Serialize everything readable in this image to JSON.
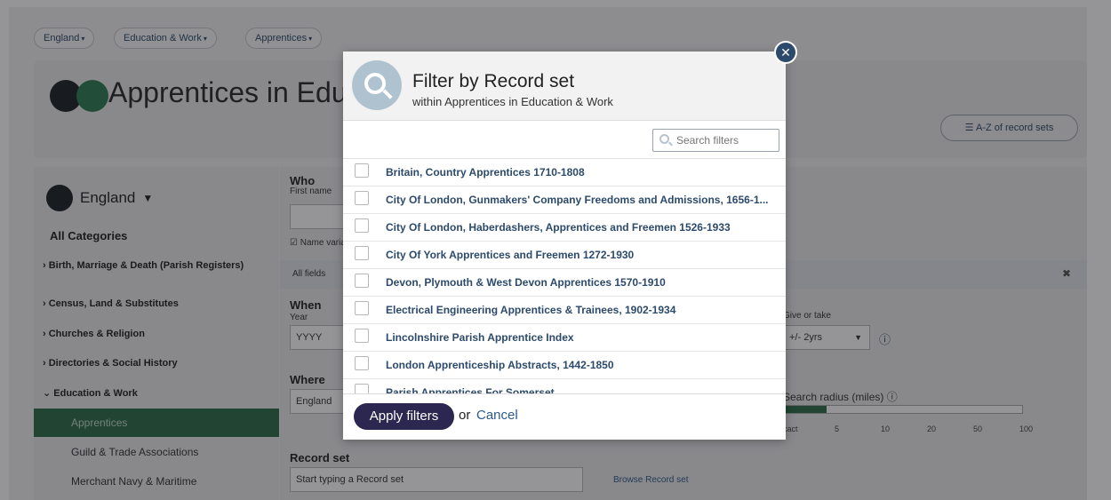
{
  "breadcrumbs": [
    {
      "label": "England"
    },
    {
      "label": "Education & Work"
    },
    {
      "label": "Apprentices"
    }
  ],
  "page": {
    "title": "Apprentices in Education & Work",
    "az_button": "A-Z of record sets"
  },
  "sidebar": {
    "region": "England",
    "all_categories": "All Categories",
    "categories": [
      {
        "label": "Birth, Marriage & Death (Parish Registers)"
      },
      {
        "label": "Census, Land & Substitutes"
      },
      {
        "label": "Churches & Religion"
      },
      {
        "label": "Directories & Social History"
      },
      {
        "label": "Education & Work"
      }
    ],
    "subcategories": [
      {
        "label": "Apprentices",
        "active": true
      },
      {
        "label": "Guild & Trade Associations",
        "active": false
      },
      {
        "label": "Merchant Navy & Maritime",
        "active": false
      }
    ]
  },
  "form": {
    "who_label": "Who",
    "first_name_label": "First name",
    "name_variants": "Name variants",
    "all_fields": "All fields",
    "when_label": "When",
    "year_label": "Year",
    "year_placeholder": "YYYY",
    "give_or_take": "Give or take",
    "give_or_take_value": "+/- 2yrs",
    "where_label": "Where",
    "where_value": "England",
    "search_radius_label": "Search radius (miles)",
    "radius_ticks": [
      "Exact",
      "5",
      "10",
      "20",
      "50",
      "100"
    ],
    "record_set_label": "Record set",
    "record_set_placeholder": "Start typing a Record set",
    "browse_record_set": "Browse Record set"
  },
  "modal": {
    "title": "Filter by Record set",
    "subtitle": "within Apprentices in Education & Work",
    "search_placeholder": "Search filters",
    "items": [
      {
        "label": "Britain, Country Apprentices 1710-1808",
        "checked": false
      },
      {
        "label": "City Of London, Gunmakers' Company Freedoms and Admissions, 1656-1...",
        "checked": false
      },
      {
        "label": "City Of London, Haberdashers, Apprentices and Freemen 1526-1933",
        "checked": false
      },
      {
        "label": "City Of York Apprentices and Freemen 1272-1930",
        "checked": false
      },
      {
        "label": "Devon, Plymouth & West Devon Apprentices 1570-1910",
        "checked": false
      },
      {
        "label": "Electrical Engineering Apprentices & Trainees, 1902-1934",
        "checked": false
      },
      {
        "label": "Lincolnshire Parish Apprentice Index",
        "checked": false
      },
      {
        "label": "London Apprenticeship Abstracts, 1442-1850",
        "checked": false
      },
      {
        "label": "Parish Apprentices For Somerset",
        "checked": false
      }
    ],
    "apply_label": "Apply filters",
    "or_text": "or",
    "cancel_label": "Cancel"
  },
  "colors": {
    "accent_green": "#2d6e48",
    "navy_button": "#2b2750",
    "link_blue": "#2c4a6b"
  }
}
